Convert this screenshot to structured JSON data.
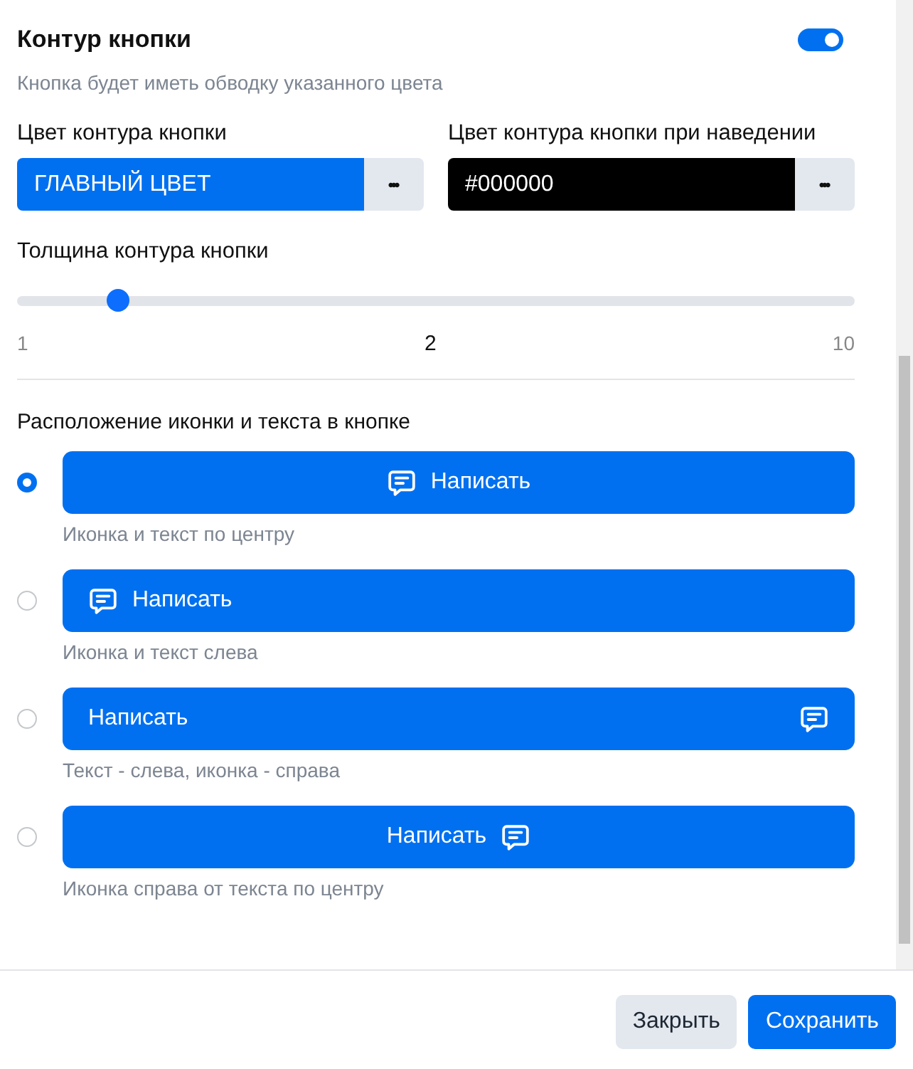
{
  "section": {
    "title": "Контур кнопки",
    "on": true,
    "description": "Кнопка будет иметь обводку указанного цвета"
  },
  "color_fields": [
    {
      "label": "Цвет контура кнопки",
      "value": "ГЛАВНЫЙ ЦВЕТ",
      "color": "#0070f0",
      "button": "•••"
    },
    {
      "label": "Цвет контура кнопки при наведении",
      "value": "#000000",
      "color": "#000000",
      "button": "•••"
    }
  ],
  "thickness": {
    "label": "Толщина контура кнопки",
    "level": 0.12,
    "min": "1",
    "value": "2",
    "max": "10"
  },
  "layout": {
    "title": "Расположение иконки и текста в кнопке",
    "options": [
      {
        "kind": "center",
        "label": "Написать",
        "caption": "Иконка и текст по центру",
        "selected": true
      },
      {
        "kind": "left",
        "label": "Написать",
        "caption": "Иконка и текст слева",
        "selected": false
      },
      {
        "kind": "split",
        "label": "Написать",
        "caption": "Текст - слева, иконка - справа",
        "selected": false
      },
      {
        "kind": "center-right",
        "label": "Написать",
        "caption": "Иконка справа от текста по центру",
        "selected": false
      }
    ]
  },
  "footer": {
    "buttons": [
      {
        "kind": "secondary",
        "label": "Закрыть"
      },
      {
        "kind": "primary",
        "label": "Сохранить"
      }
    ]
  }
}
